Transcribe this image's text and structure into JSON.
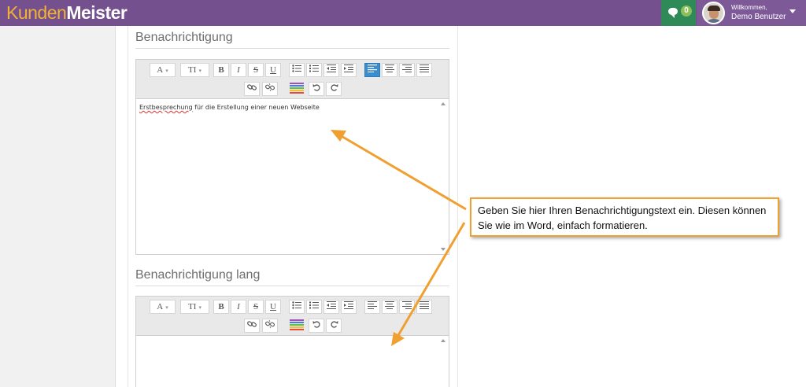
{
  "app": {
    "logo_part1": "Kunden",
    "logo_part2": "Meister",
    "brand_color": "#75508f",
    "accent_color": "#f2b233"
  },
  "header": {
    "chat_icon": "chat-bubble-icon",
    "chat_count": "0",
    "welcome": "Willkommen,",
    "username": "Demo Benutzer"
  },
  "toolbar_buttons": {
    "font": "A",
    "size": "TI",
    "bold": "B",
    "italic": "I",
    "strike": "S",
    "underline": "U",
    "active_color": "#3c8dce"
  },
  "section1": {
    "title": "Benachrichtigung",
    "text_misspelled": "Erstbesprechung",
    "text_rest": " für die Erstellung einer neuen Webseite",
    "align_left_active": true
  },
  "section2": {
    "title": "Benachrichtigung lang",
    "text": ""
  },
  "callout": {
    "text": "Geben Sie hier Ihren Benachrichtigungstext ein. Diesen können Sie wie im Word, einfach formatieren.",
    "border_color": "#f0a030"
  }
}
